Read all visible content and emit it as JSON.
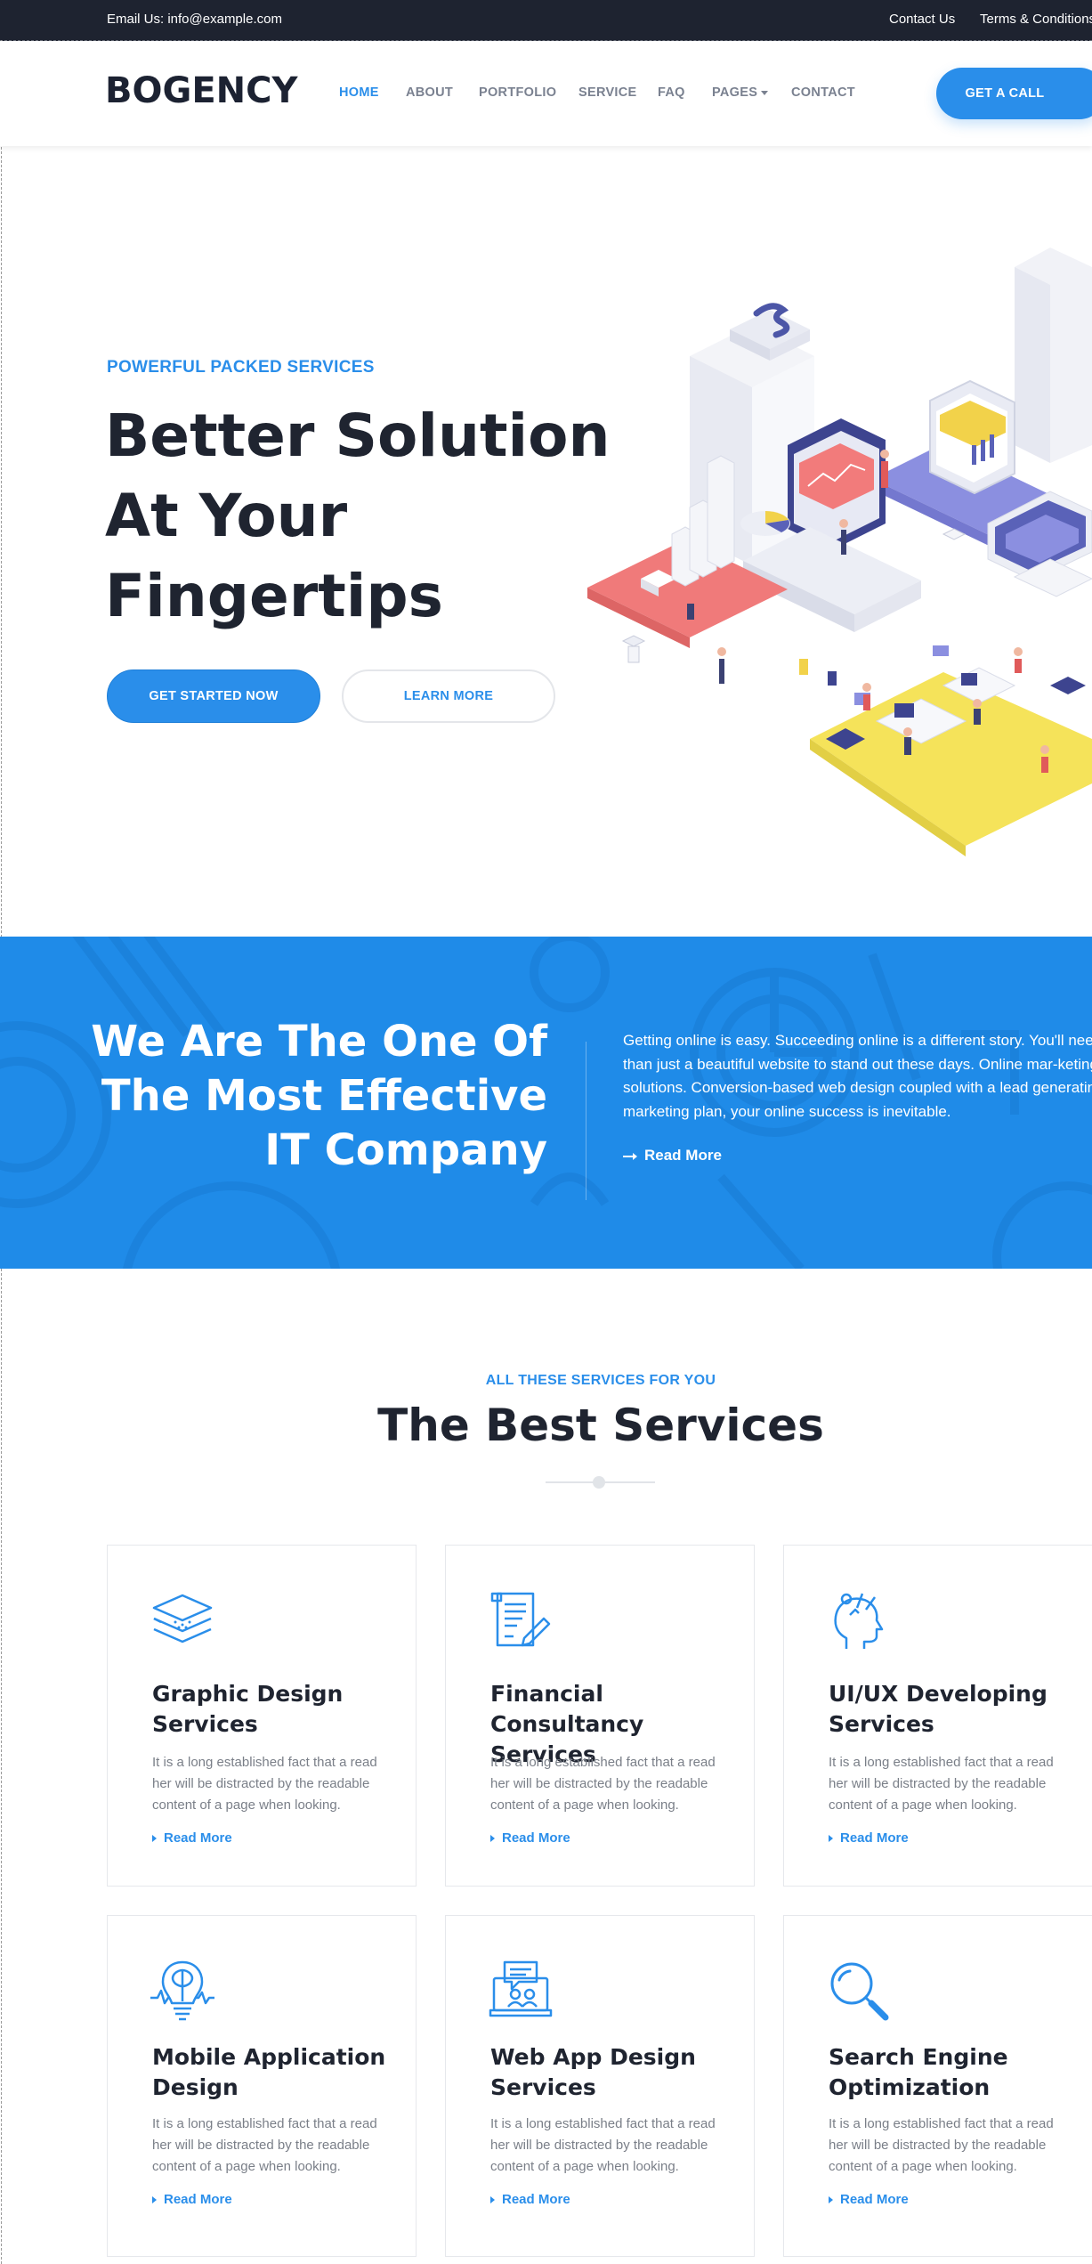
{
  "topbar": {
    "email": "Email Us: info@example.com",
    "links": [
      "Contact Us",
      "Terms & Conditions"
    ]
  },
  "header": {
    "logo": "BOGENCY",
    "nav": [
      "HOME",
      "ABOUT",
      "PORTFOLIO",
      "SERVICE",
      "FAQ",
      "PAGES",
      "CONTACT"
    ],
    "cta": "GET A CALL"
  },
  "hero": {
    "eyebrow": "POWERFUL PACKED SERVICES",
    "title_lines": [
      "Better Solution",
      "At Your",
      "Fingertips"
    ],
    "primary_button": "GET STARTED NOW",
    "secondary_button": "LEARN MORE"
  },
  "band": {
    "title_lines": [
      "We Are The One Of",
      "The Most Effective",
      "IT Company"
    ],
    "text": "Getting online is easy. Succeeding online is a different story. You'll need than just a beautiful website to stand out these days. Online mar-keting solutions. Conversion-based web design coupled with a lead generating marketing plan, your online success is inevitable.",
    "link": "Read More"
  },
  "services": {
    "eyebrow": "ALL THESE SERVICES FOR YOU",
    "title": "The Best Services",
    "cards": [
      {
        "icon": "layers-icon",
        "title": "Graphic Design Services",
        "desc": "It is a long established fact that a read her will be distracted by the readable content of a page when looking.",
        "link": "Read More"
      },
      {
        "icon": "document-pen-icon",
        "title": "Financial Consultancy Services",
        "desc": "It is a long established fact that a read her will be distracted by the readable content of a page when looking.",
        "link": "Read More"
      },
      {
        "icon": "creative-head-icon",
        "title": "UI/UX Developing Services",
        "desc": "It is a long established fact that a read her will be distracted by the readable content of a page when looking.",
        "link": "Read More"
      },
      {
        "icon": "lightbulb-brain-icon",
        "title": "Mobile Application Design",
        "desc": "It is a long established fact that a read her will be distracted by the readable content of a page when looking.",
        "link": "Read More"
      },
      {
        "icon": "laptop-chat-icon",
        "title": "Web App Design Services",
        "desc": "It is a long established fact that a read her will be distracted by the readable content of a page when looking.",
        "link": "Read More"
      },
      {
        "icon": "magnifier-icon",
        "title": "Search Engine Optimization",
        "desc": "It is a long established fact that a read her will be distracted by the readable content of a page when looking.",
        "link": "Read More"
      }
    ]
  },
  "colors": {
    "accent": "#2a8eea",
    "dark": "#1f2430",
    "topbar": "#1e2330",
    "band": "#1f8be8"
  }
}
